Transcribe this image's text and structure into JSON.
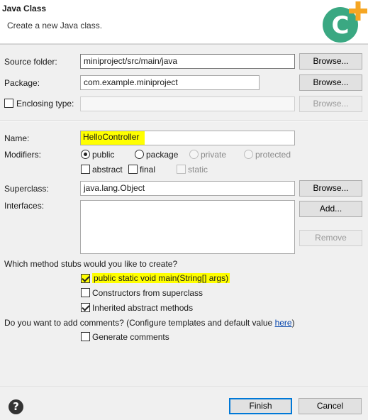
{
  "dialog": {
    "title": "Java Class",
    "subtitle": "Create a new Java class.",
    "logo_icon": "new-class-plus-icon",
    "accent_color": "#3aa882",
    "plus_color": "#f5a623"
  },
  "source_folder": {
    "label": "Source folder:",
    "value": "miniproject/src/main/java",
    "browse": "Browse..."
  },
  "package": {
    "label": "Package:",
    "value": "com.example.miniproject",
    "browse": "Browse..."
  },
  "enclosing": {
    "label": "Enclosing type:",
    "value": "",
    "browse": "Browse...",
    "checked": false
  },
  "name": {
    "label": "Name:",
    "value": "HelloController"
  },
  "modifiers": {
    "label": "Modifiers:",
    "public": "public",
    "package": "package",
    "private": "private",
    "protected": "protected",
    "abstract": "abstract",
    "final": "final",
    "static": "static",
    "selected": "public"
  },
  "superclass": {
    "label": "Superclass:",
    "value": "java.lang.Object",
    "browse": "Browse..."
  },
  "interfaces": {
    "label": "Interfaces:",
    "add": "Add...",
    "remove": "Remove"
  },
  "stubs": {
    "question": "Which method stubs would you like to create?",
    "main": "public static void main(String[] args)",
    "main_checked": true,
    "constructors": "Constructors from superclass",
    "constructors_checked": false,
    "inherited": "Inherited abstract methods",
    "inherited_checked": true
  },
  "comments": {
    "question_prefix": "Do you want to add comments? (Configure templates and default value ",
    "link": "here",
    "question_suffix": ")",
    "generate": "Generate comments",
    "generate_checked": false
  },
  "footer": {
    "help_icon": "help-icon",
    "finish": "Finish",
    "cancel": "Cancel"
  }
}
